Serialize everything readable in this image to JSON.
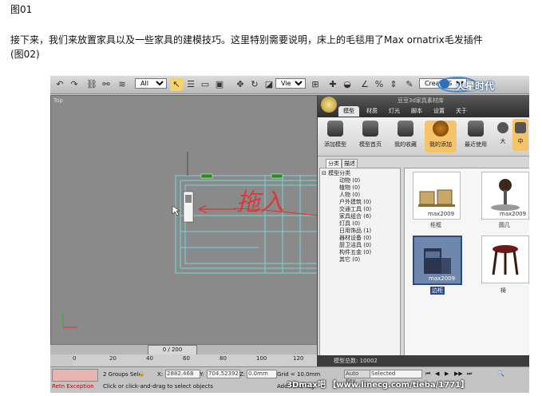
{
  "article": {
    "fig1_label": "图01",
    "paragraph": "接下来，我们来放置家具以及一些家具的建模技巧。这里特别需要说明，床上的毛毯用了Max ornatrix毛发插件",
    "fig2_label": "(图02)"
  },
  "toolbar": {
    "selection_filter": "All",
    "ref_coord": "View",
    "named_selection": "Create Selection Set"
  },
  "viewport": {
    "label": "Top",
    "annotation": "拖入"
  },
  "timeline": {
    "frame_counter": "0 / 200",
    "ticks": [
      "0",
      "20",
      "40",
      "60",
      "80",
      "100",
      "120"
    ]
  },
  "status": {
    "script_listener": "Retn Exception",
    "selection_info": "2 Groups Sele",
    "prompt": "Click or click-and-drag to select objects",
    "x_label": "X:",
    "x_value": "2882.468",
    "y_label": "Y:",
    "y_value": "704.52392",
    "z_label": "Z:",
    "z_value": "0.0mm",
    "grid": "Grid = 10.0mm",
    "add_time_tag": "Add Time Tag",
    "auto_key": "Auto Key",
    "key_mode": "Selected"
  },
  "plugin": {
    "title_bar": "豆豆3d家具素材库",
    "tabs": [
      "模型",
      "材质",
      "灯光",
      "脚本",
      "设置",
      "关于"
    ],
    "active_tab": 0,
    "ribbon": [
      {
        "label": "添加模型"
      },
      {
        "label": "模型首页"
      },
      {
        "label": "我的收藏"
      },
      {
        "label": "我的添加"
      },
      {
        "label": "最近使用"
      }
    ],
    "size_buttons": [
      "大",
      "中"
    ],
    "subtabs": [
      "分类",
      "描述"
    ],
    "tree_root": "模型分类",
    "categories": [
      "动物 (0)",
      "植物 (0)",
      "人物 (0)",
      "户外建筑 (0)",
      "交通工具 (0)",
      "家具组合 (6)",
      "灯具 (0)",
      "日用饰品 (1)",
      "器材设备 (0)",
      "厨卫洁具 (0)",
      "构件五金 (0)",
      "其它 (0)"
    ],
    "items": [
      {
        "caption": "柜框",
        "version": "max2009"
      },
      {
        "caption": "圆几",
        "version": "max2009"
      },
      {
        "caption": "边柜",
        "version": "max2009"
      },
      {
        "caption": "椅",
        "version": "max2009"
      }
    ],
    "footer": "模型总数: 10002"
  },
  "watermark": {
    "brand": "火星时代",
    "site": "3Dmax吧 【www.linecg.com/tieba/1771】"
  },
  "colors": {
    "viewport_bg": "#8a8a8a",
    "outline": "#79d4d4",
    "annotation_red": "#e23030"
  }
}
